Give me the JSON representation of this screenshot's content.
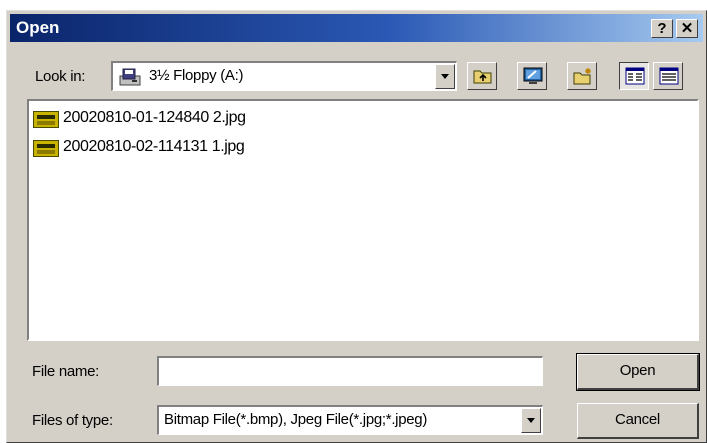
{
  "dialog": {
    "title": "Open",
    "help_label": "?",
    "close_label": "✕"
  },
  "look_in": {
    "label": "Look in:",
    "value": "3½ Floppy (A:)"
  },
  "toolbar": {
    "buttons": [
      "up-one-level",
      "desktop",
      "create-new-folder",
      "list-view",
      "details-view"
    ],
    "pressed": "list-view"
  },
  "files": [
    {
      "name": "20020810-01-124840 2.jpg",
      "type": "JPG"
    },
    {
      "name": "20020810-02-114131 1.jpg",
      "type": "JPG"
    }
  ],
  "file_name": {
    "label": "File name:",
    "value": ""
  },
  "files_of_type": {
    "label": "Files of type:",
    "value": "Bitmap File(*.bmp), Jpeg File(*.jpg;*.jpeg)"
  },
  "buttons": {
    "open": "Open",
    "cancel": "Cancel"
  }
}
